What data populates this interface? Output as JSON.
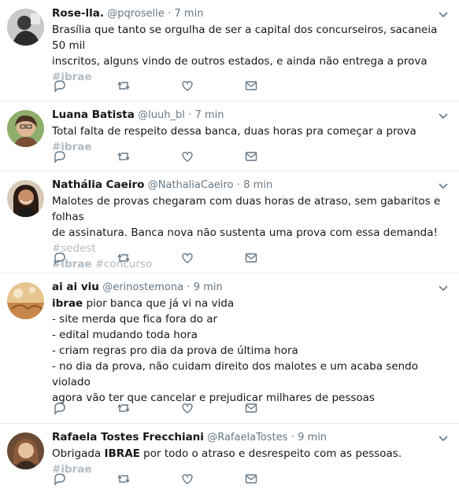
{
  "tweets": [
    {
      "name": "Rose-lla.",
      "handle": "@pqroselle",
      "dot": "·",
      "time": "7 min",
      "lines": [
        "Brasília que tanto se orgulha de ser a capital dos concurseiros, sacaneia 50 mil",
        "inscritos, alguns vindo de outros estados, e ainda não entrega a prova"
      ],
      "hashtag_line": "#ibrae"
    },
    {
      "name": "Luana Batista",
      "handle": "@luuh_bl",
      "dot": "·",
      "time": "7 min",
      "text": "Total falta de respeito dessa banca, duas horas pra começar a prova ",
      "hashtag": "#ibrae"
    },
    {
      "name": "Nathália Caeiro",
      "handle": "@NathaliaCaeiro",
      "dot": "·",
      "time": "8 min",
      "line1": "Malotes de provas chegaram com duas horas de atraso, sem gabaritos e folhas",
      "line2": "de assinatura. Banca nova não sustenta uma prova com essa demanda! ",
      "tag_sedest": "#sedest",
      "tag_ibrae": "#ibrae",
      "tag_concurso": "#concurso"
    },
    {
      "name": "ai ai viu",
      "handle": "@erinostemona",
      "dot": "·",
      "time": "9 min",
      "bold_start": "ibrae",
      "line1_rest": " pior banca que já vi na vida",
      "lines": [
        "- site merda que fica fora do ar",
        "- edital mudando toda hora",
        "- criam regras pro dia da prova de última hora",
        "- no dia da prova, não cuidam direito dos malotes e um acaba sendo violado",
        "agora vão ter que cancelar e prejudicar milhares de pessoas"
      ]
    },
    {
      "name": "Rafaela Tostes Frecchiani",
      "handle": "@RafaelaTostes",
      "dot": "·",
      "time": "9 min",
      "pre": "Obrigada ",
      "bold": "IBRAE",
      "post": " por todo o atraso e desrespeito com as pessoas. ",
      "hashtag": "#ibrae"
    }
  ],
  "icons": {
    "reply": "reply-icon",
    "retweet": "retweet-icon",
    "like": "heart-icon",
    "message": "envelope-icon",
    "menu": "chevron-down-icon"
  },
  "colors": {
    "text": "#14171a",
    "secondary": "#657786",
    "hashtag": "#b1bcc5",
    "border": "#e6ecf0"
  }
}
